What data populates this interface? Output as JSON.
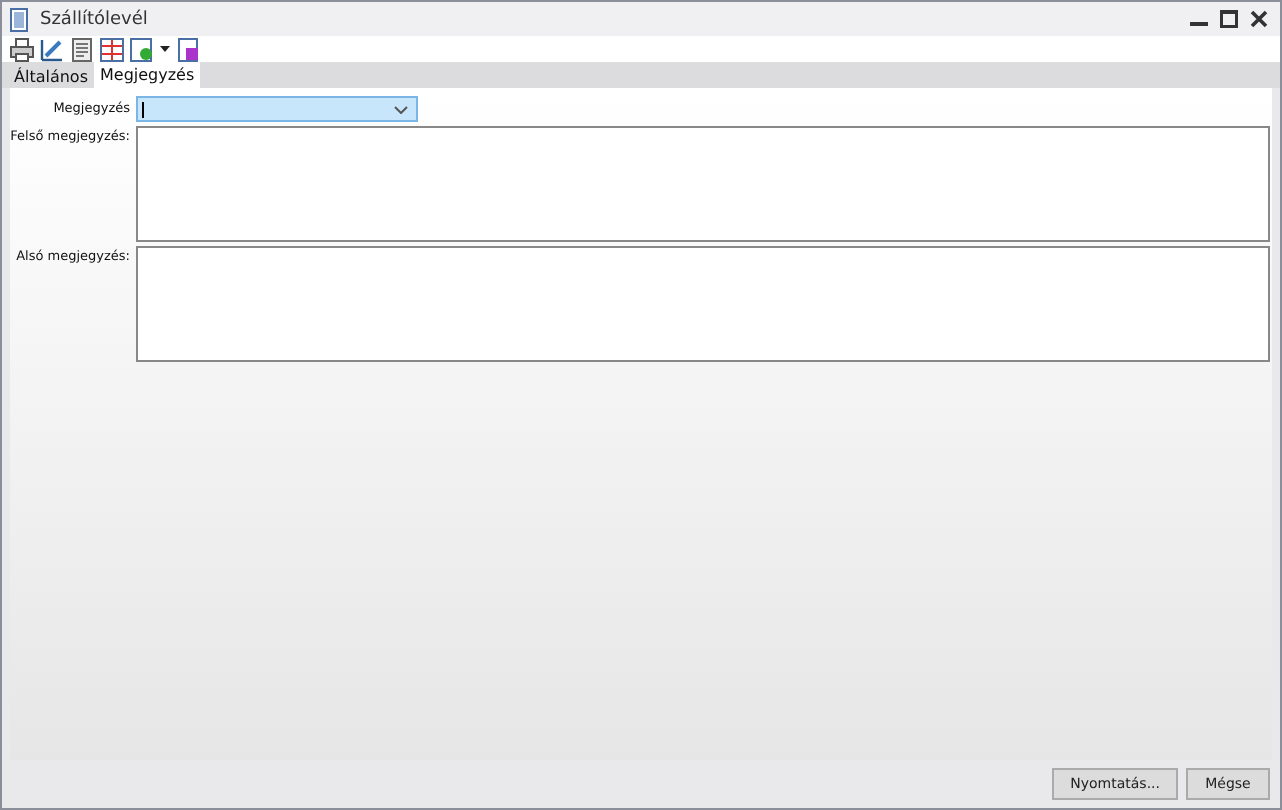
{
  "window": {
    "title": "Szállítólevél"
  },
  "tabs": [
    {
      "label": "Általános",
      "selected": false
    },
    {
      "label": "Megjegyzés",
      "selected": true
    }
  ],
  "fields": [
    {
      "kind": "combo",
      "label": "Megjegyzés",
      "focused": true
    },
    {
      "kind": "memo",
      "label": "Felső megjegyzés:",
      "focused": false
    },
    {
      "kind": "memo",
      "label": "Alsó megjegyzés:",
      "focused": false
    }
  ],
  "buttons": [
    "Nyomtatás...",
    "Mégse"
  ]
}
